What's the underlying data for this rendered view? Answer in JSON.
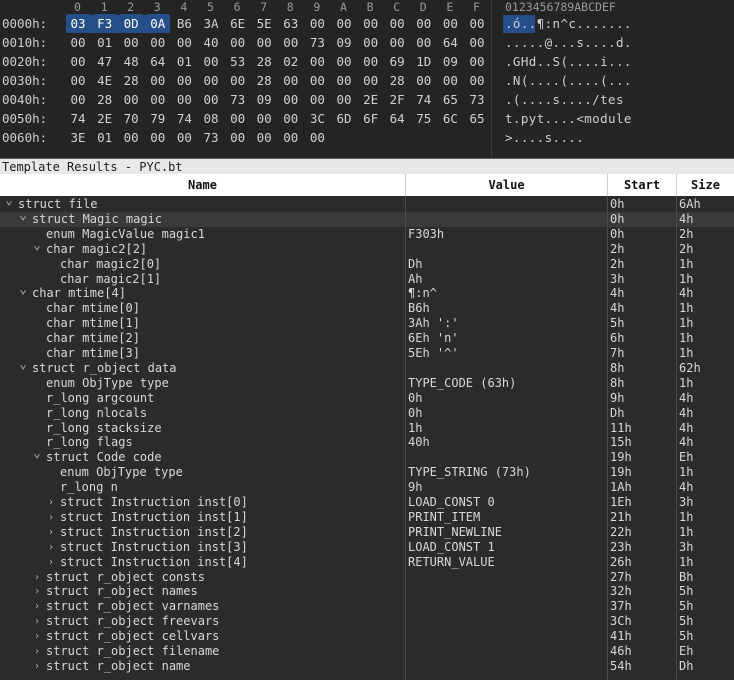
{
  "hex": {
    "column_headers": [
      "0",
      "1",
      "2",
      "3",
      "4",
      "5",
      "6",
      "7",
      "8",
      "9",
      "A",
      "B",
      "C",
      "D",
      "E",
      "F"
    ],
    "ascii_header": "0123456789ABCDEF",
    "rows": [
      {
        "offset": "0000h:",
        "bytes": [
          "03",
          "F3",
          "0D",
          "0A",
          "B6",
          "3A",
          "6E",
          "5E",
          "63",
          "00",
          "00",
          "00",
          "00",
          "00",
          "00",
          "00"
        ],
        "ascii": ".ó..¶:n^c......."
      },
      {
        "offset": "0010h:",
        "bytes": [
          "00",
          "01",
          "00",
          "00",
          "00",
          "40",
          "00",
          "00",
          "00",
          "73",
          "09",
          "00",
          "00",
          "00",
          "64",
          "00"
        ],
        "ascii": ".....@...s....d."
      },
      {
        "offset": "0020h:",
        "bytes": [
          "00",
          "47",
          "48",
          "64",
          "01",
          "00",
          "53",
          "28",
          "02",
          "00",
          "00",
          "00",
          "69",
          "1D",
          "09",
          "00"
        ],
        "ascii": ".GHd..S(....i..."
      },
      {
        "offset": "0030h:",
        "bytes": [
          "00",
          "4E",
          "28",
          "00",
          "00",
          "00",
          "00",
          "28",
          "00",
          "00",
          "00",
          "00",
          "28",
          "00",
          "00",
          "00"
        ],
        "ascii": ".N(....(....(..."
      },
      {
        "offset": "0040h:",
        "bytes": [
          "00",
          "28",
          "00",
          "00",
          "00",
          "00",
          "73",
          "09",
          "00",
          "00",
          "00",
          "2E",
          "2F",
          "74",
          "65",
          "73"
        ],
        "ascii": ".(....s..../tes"
      },
      {
        "offset": "0050h:",
        "bytes": [
          "74",
          "2E",
          "70",
          "79",
          "74",
          "08",
          "00",
          "00",
          "00",
          "3C",
          "6D",
          "6F",
          "64",
          "75",
          "6C",
          "65"
        ],
        "ascii": "t.pyt....<module"
      },
      {
        "offset": "0060h:",
        "bytes": [
          "3E",
          "01",
          "00",
          "00",
          "00",
          "73",
          "00",
          "00",
          "00",
          "00"
        ],
        "ascii": ">....s...."
      }
    ],
    "selected_bytes": 4
  },
  "template": {
    "title": "Template Results - PYC.bt",
    "columns": {
      "name": "Name",
      "value": "Value",
      "start": "Start",
      "size": "Size"
    },
    "rows": [
      {
        "name": "struct file",
        "value": "",
        "start": "0h",
        "size": "6Ah",
        "indent": 0,
        "arrow": "open"
      },
      {
        "name": "struct Magic magic",
        "value": "",
        "start": "0h",
        "size": "4h",
        "indent": 1,
        "arrow": "open",
        "selected": true
      },
      {
        "name": "enum MagicValue magic1",
        "value": "F303h",
        "start": "0h",
        "size": "2h",
        "indent": 2,
        "arrow": ""
      },
      {
        "name": "char magic2[2]",
        "value": "",
        "start": "2h",
        "size": "2h",
        "indent": 2,
        "arrow": "open"
      },
      {
        "name": "char magic2[0]",
        "value": "Dh",
        "start": "2h",
        "size": "1h",
        "indent": 3,
        "arrow": ""
      },
      {
        "name": "char magic2[1]",
        "value": "Ah",
        "start": "3h",
        "size": "1h",
        "indent": 3,
        "arrow": ""
      },
      {
        "name": "char mtime[4]",
        "value": "¶:n^",
        "start": "4h",
        "size": "4h",
        "indent": 1,
        "arrow": "open"
      },
      {
        "name": "char mtime[0]",
        "value": "B6h",
        "start": "4h",
        "size": "1h",
        "indent": 2,
        "arrow": ""
      },
      {
        "name": "char mtime[1]",
        "value": "3Ah ':'",
        "start": "5h",
        "size": "1h",
        "indent": 2,
        "arrow": ""
      },
      {
        "name": "char mtime[2]",
        "value": "6Eh 'n'",
        "start": "6h",
        "size": "1h",
        "indent": 2,
        "arrow": ""
      },
      {
        "name": "char mtime[3]",
        "value": "5Eh '^'",
        "start": "7h",
        "size": "1h",
        "indent": 2,
        "arrow": ""
      },
      {
        "name": "struct r_object data",
        "value": "",
        "start": "8h",
        "size": "62h",
        "indent": 1,
        "arrow": "open"
      },
      {
        "name": "enum ObjType type",
        "value": "TYPE_CODE (63h)",
        "start": "8h",
        "size": "1h",
        "indent": 2,
        "arrow": ""
      },
      {
        "name": "r_long argcount",
        "value": "0h",
        "start": "9h",
        "size": "4h",
        "indent": 2,
        "arrow": ""
      },
      {
        "name": "r_long nlocals",
        "value": "0h",
        "start": "Dh",
        "size": "4h",
        "indent": 2,
        "arrow": ""
      },
      {
        "name": "r_long stacksize",
        "value": "1h",
        "start": "11h",
        "size": "4h",
        "indent": 2,
        "arrow": ""
      },
      {
        "name": "r_long flags",
        "value": "40h",
        "start": "15h",
        "size": "4h",
        "indent": 2,
        "arrow": ""
      },
      {
        "name": "struct Code code",
        "value": "",
        "start": "19h",
        "size": "Eh",
        "indent": 2,
        "arrow": "open"
      },
      {
        "name": "enum ObjType type",
        "value": "TYPE_STRING (73h)",
        "start": "19h",
        "size": "1h",
        "indent": 3,
        "arrow": ""
      },
      {
        "name": "r_long n",
        "value": "9h",
        "start": "1Ah",
        "size": "4h",
        "indent": 3,
        "arrow": ""
      },
      {
        "name": "struct Instruction inst[0]",
        "value": "LOAD_CONST 0",
        "start": "1Eh",
        "size": "3h",
        "indent": 3,
        "arrow": "closed"
      },
      {
        "name": "struct Instruction inst[1]",
        "value": "PRINT_ITEM",
        "start": "21h",
        "size": "1h",
        "indent": 3,
        "arrow": "closed"
      },
      {
        "name": "struct Instruction inst[2]",
        "value": "PRINT_NEWLINE",
        "start": "22h",
        "size": "1h",
        "indent": 3,
        "arrow": "closed"
      },
      {
        "name": "struct Instruction inst[3]",
        "value": "LOAD_CONST 1",
        "start": "23h",
        "size": "3h",
        "indent": 3,
        "arrow": "closed"
      },
      {
        "name": "struct Instruction inst[4]",
        "value": "RETURN_VALUE",
        "start": "26h",
        "size": "1h",
        "indent": 3,
        "arrow": "closed"
      },
      {
        "name": "struct r_object consts",
        "value": "",
        "start": "27h",
        "size": "Bh",
        "indent": 2,
        "arrow": "closed"
      },
      {
        "name": "struct r_object names",
        "value": "",
        "start": "32h",
        "size": "5h",
        "indent": 2,
        "arrow": "closed"
      },
      {
        "name": "struct r_object varnames",
        "value": "",
        "start": "37h",
        "size": "5h",
        "indent": 2,
        "arrow": "closed"
      },
      {
        "name": "struct r_object freevars",
        "value": "",
        "start": "3Ch",
        "size": "5h",
        "indent": 2,
        "arrow": "closed"
      },
      {
        "name": "struct r_object cellvars",
        "value": "",
        "start": "41h",
        "size": "5h",
        "indent": 2,
        "arrow": "closed"
      },
      {
        "name": "struct r_object filename",
        "value": "",
        "start": "46h",
        "size": "Eh",
        "indent": 2,
        "arrow": "closed"
      },
      {
        "name": "struct r_object name",
        "value": "",
        "start": "54h",
        "size": "Dh",
        "indent": 2,
        "arrow": "closed"
      }
    ]
  }
}
